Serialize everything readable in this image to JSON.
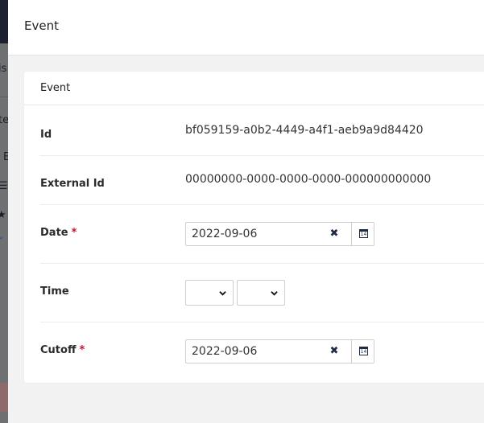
{
  "background": {
    "fragments": [
      "is",
      "te",
      "E",
      "☰",
      "★",
      "˅"
    ]
  },
  "panel": {
    "title": "Event"
  },
  "card": {
    "title": "Event",
    "id": {
      "label": "Id",
      "value": "bf059159-a0b2-4449-a4f1-aeb9a9d84420"
    },
    "external_id": {
      "label": "External Id",
      "value": "00000000-0000-0000-0000-000000000000"
    },
    "date": {
      "label": "Date",
      "required_mark": "*",
      "value": "2022-09-06",
      "clear_glyph": "✖",
      "calendar_glyph": "14"
    },
    "time": {
      "label": "Time",
      "hour_value": "",
      "minute_value": ""
    },
    "cutoff": {
      "label": "Cutoff",
      "required_mark": "*",
      "value": "2022-09-06",
      "clear_glyph": "✖",
      "calendar_glyph": "14"
    }
  }
}
